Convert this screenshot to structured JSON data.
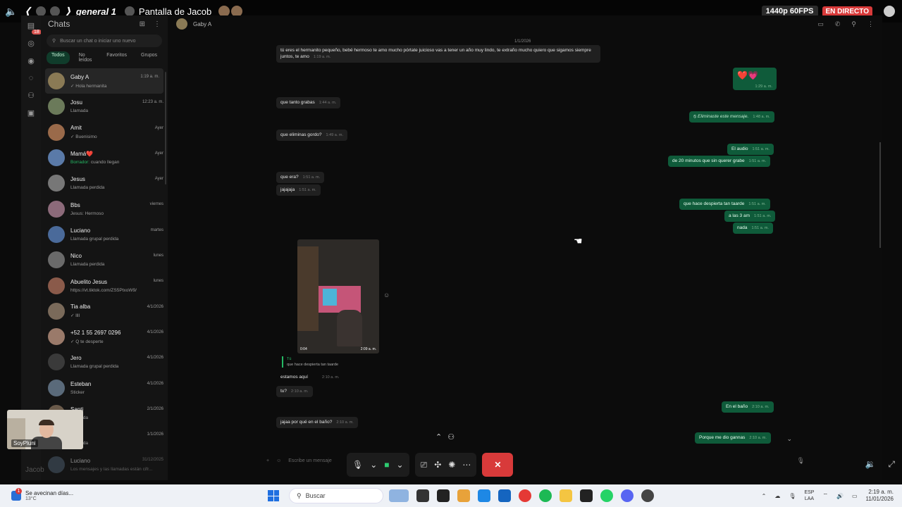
{
  "stream": {
    "server_name": "general 1",
    "title": "Pantalla de Jacob",
    "quality": "1440p 60FPS",
    "live_label": "EN DIRECTO"
  },
  "whatsapp": {
    "chats_header": "Chats",
    "unread_badge": "18",
    "search_placeholder": "Buscar un chat o iniciar uno nuevo",
    "filters": [
      "Todos",
      "No leídos",
      "Favoritos",
      "Grupos"
    ],
    "chats": [
      {
        "name": "Gaby A",
        "preview": "✓ Hola hermanita",
        "time": "1:19 a. m."
      },
      {
        "name": "Josu",
        "preview": "Llamada",
        "time": "12:23 a. m."
      },
      {
        "name": "Amit",
        "preview": "✓ Buenisimo",
        "time": "Ayer"
      },
      {
        "name": "Mamá❤️",
        "draft_label": "Borrador:",
        "preview": " cuando llegan",
        "time": "Ayer"
      },
      {
        "name": "Jesus",
        "preview": "Llamada perdida",
        "time": "Ayer"
      },
      {
        "name": "Bbs",
        "preview": "Jesus: Hermoso",
        "time": "viernes"
      },
      {
        "name": "Luciano",
        "preview": "Llamada grupal perdida",
        "time": "martes"
      },
      {
        "name": "Nico",
        "preview": "Llamada perdida",
        "time": "lunes"
      },
      {
        "name": "Abuelito Jesus",
        "preview": "https://vt.tiktok.com/ZS5PtxoW9/",
        "time": "lunes"
      },
      {
        "name": "Tia alba",
        "preview": "✓ llll",
        "time": "4/1/2026"
      },
      {
        "name": "+52 1 55 2697 0296",
        "preview": "✓ Q te desperte",
        "time": "4/1/2026"
      },
      {
        "name": "Jero",
        "preview": "Llamada grupal perdida",
        "time": "4/1/2026"
      },
      {
        "name": "Esteban",
        "preview": "Sticker",
        "time": "4/1/2026"
      },
      {
        "name": "Santi",
        "preview": "Llamada",
        "time": "2/1/2026"
      },
      {
        "name": "G",
        "preview": "Llamada",
        "time": "1/1/2026"
      },
      {
        "name": "Luciano",
        "preview": "Los mensajes y las llamadas están cifr...",
        "time": "31/12/2025"
      }
    ],
    "contact_name": "Gaby A",
    "date_chip": "1/1/2026",
    "messages": [
      {
        "text": "tú eres el hermanito pequeño, bebé hermoso te amo mucho pórtate juicioso vas a tener un año muy lindo, te extraño mucho quiero que sigamos siempre juntos, te amo",
        "time": "1:19 a. m."
      },
      {
        "text": "❤️💗",
        "time": "1:29 a. m."
      },
      {
        "text": "que tanto grabas",
        "time": "1:44 a. m."
      },
      {
        "text": "Eliminaste este mensaje.",
        "time": "1:48 a. m."
      },
      {
        "text": "que eliminas gordo?",
        "time": "1:49 a. m."
      },
      {
        "text": "El audio",
        "time": "1:51 a. m."
      },
      {
        "text": "de 20 minutos que sin querer grabe",
        "time": "1:51 a. m."
      },
      {
        "text": "que era?",
        "time": "1:51 a. m."
      },
      {
        "text": "jajajaja",
        "time": "1:51 a. m."
      },
      {
        "text": "que hace despierta tan taarde",
        "time": "1:51 a. m."
      },
      {
        "text": "a las 3 am",
        "time": "1:51 a. m."
      },
      {
        "text": "nada",
        "time": "1:51 a. m."
      },
      {
        "text": "estamos aquí",
        "time": "2:10 a. m."
      },
      {
        "text": "tu?",
        "time": "2:10 a. m."
      },
      {
        "text": "En el baño",
        "time": "2:10 a. m."
      },
      {
        "text": "jajaa por qué en el baño?",
        "time": "2:10 a. m."
      },
      {
        "text": "Porque me dio gannas",
        "time": "2:10 a. m."
      }
    ],
    "media_duration": "0:04",
    "media_time": "2:09 a. m.",
    "quote_author": "Tú",
    "quote_text": "que hace despierta tan taarde",
    "composer_placeholder": "Escribe un mensaje"
  },
  "webcam_name": "SoyPluni",
  "webcam_name2": "Jacob",
  "taskbar": {
    "weather_title": "Se avecinan días...",
    "weather_temp": "13°C",
    "weather_badge": "1",
    "search_label": "Buscar",
    "lang_top": "ESP",
    "lang_bottom": "LAA",
    "time": "2:19 a. m.",
    "date": "11/01/2026"
  }
}
